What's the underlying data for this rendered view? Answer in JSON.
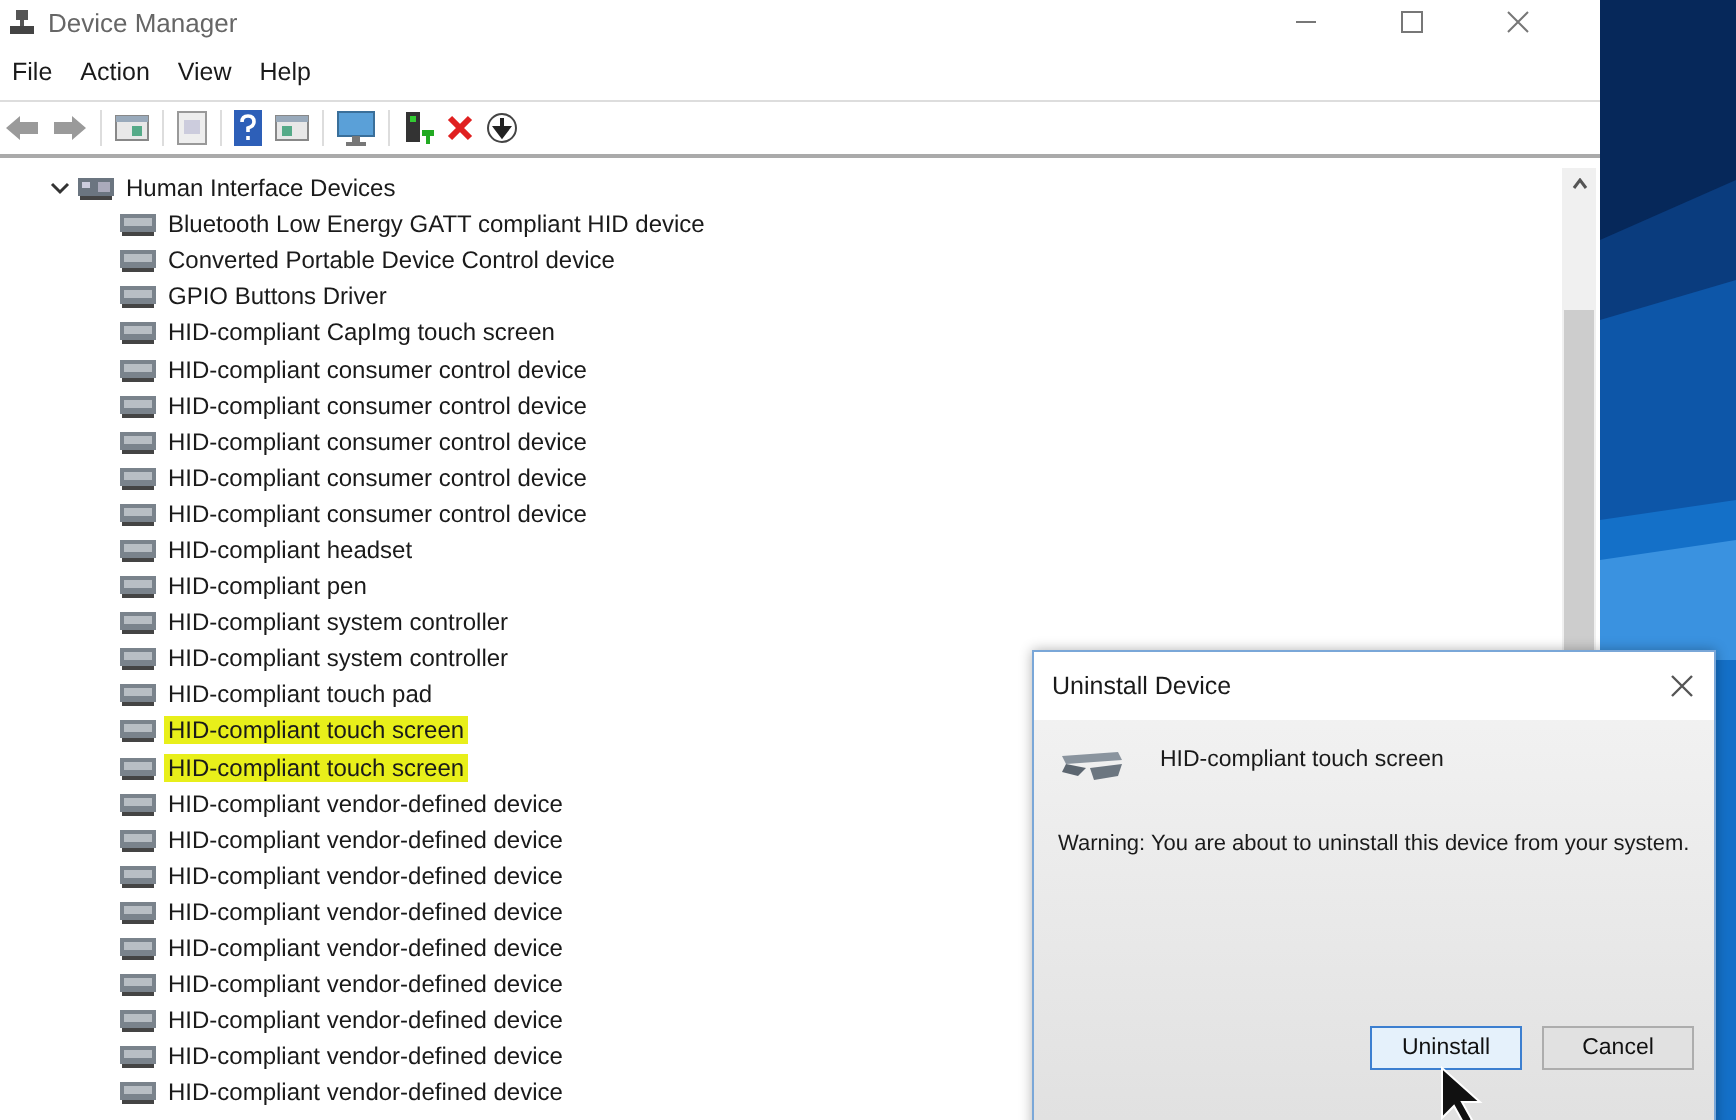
{
  "window": {
    "title": "Device Manager"
  },
  "menu": [
    "File",
    "Action",
    "View",
    "Help"
  ],
  "tree": {
    "label": "Human Interface Devices",
    "expanded": true,
    "children": [
      {
        "label": "Bluetooth Low Energy GATT compliant HID device",
        "highlighted": false
      },
      {
        "label": "Converted Portable Device Control device",
        "highlighted": false
      },
      {
        "label": "GPIO Buttons Driver",
        "highlighted": false
      },
      {
        "label": "HID-compliant CapImg touch screen",
        "highlighted": false
      },
      {
        "label": "HID-compliant consumer control device",
        "highlighted": false
      },
      {
        "label": "HID-compliant consumer control device",
        "highlighted": false
      },
      {
        "label": "HID-compliant consumer control device",
        "highlighted": false
      },
      {
        "label": "HID-compliant consumer control device",
        "highlighted": false
      },
      {
        "label": "HID-compliant consumer control device",
        "highlighted": false
      },
      {
        "label": "HID-compliant headset",
        "highlighted": false
      },
      {
        "label": "HID-compliant pen",
        "highlighted": false
      },
      {
        "label": "HID-compliant system controller",
        "highlighted": false
      },
      {
        "label": "HID-compliant system controller",
        "highlighted": false
      },
      {
        "label": "HID-compliant touch pad",
        "highlighted": false
      },
      {
        "label": "HID-compliant touch screen",
        "highlighted": true
      },
      {
        "label": "HID-compliant touch screen",
        "highlighted": true
      },
      {
        "label": "HID-compliant vendor-defined device",
        "highlighted": false
      },
      {
        "label": "HID-compliant vendor-defined device",
        "highlighted": false
      },
      {
        "label": "HID-compliant vendor-defined device",
        "highlighted": false
      },
      {
        "label": "HID-compliant vendor-defined device",
        "highlighted": false
      },
      {
        "label": "HID-compliant vendor-defined device",
        "highlighted": false
      },
      {
        "label": "HID-compliant vendor-defined device",
        "highlighted": false
      },
      {
        "label": "HID-compliant vendor-defined device",
        "highlighted": false
      },
      {
        "label": "HID-compliant vendor-defined device",
        "highlighted": false
      },
      {
        "label": "HID-compliant vendor-defined device",
        "highlighted": false
      }
    ]
  },
  "dialog": {
    "title": "Uninstall Device",
    "device": "HID-compliant touch screen",
    "warning": "Warning: You are about to uninstall this device from your system.",
    "buttons": [
      {
        "label": "Uninstall",
        "focused": true
      },
      {
        "label": "Cancel",
        "focused": false
      }
    ]
  }
}
